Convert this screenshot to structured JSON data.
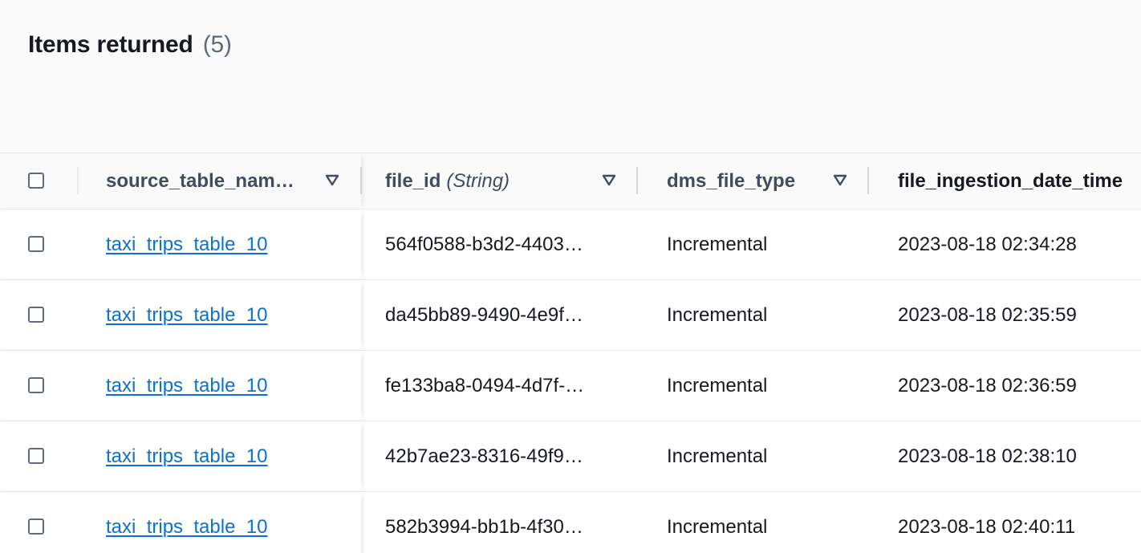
{
  "header": {
    "title": "Items returned",
    "count": "(5)"
  },
  "table": {
    "columns": [
      {
        "label": "source_table_nam…",
        "type": ""
      },
      {
        "label": "file_id",
        "type": "(String)"
      },
      {
        "label": "dms_file_type",
        "type": ""
      },
      {
        "label": "file_ingestion_date_time",
        "type": ""
      }
    ],
    "rows": [
      {
        "source_table_name": "taxi_trips_table_10",
        "file_id": "564f0588-b3d2-4403…",
        "dms_file_type": "Incremental",
        "file_ingestion_date_time": "2023-08-18 02:34:28"
      },
      {
        "source_table_name": "taxi_trips_table_10",
        "file_id": "da45bb89-9490-4e9f…",
        "dms_file_type": "Incremental",
        "file_ingestion_date_time": "2023-08-18 02:35:59"
      },
      {
        "source_table_name": "taxi_trips_table_10",
        "file_id": "fe133ba8-0494-4d7f-…",
        "dms_file_type": "Incremental",
        "file_ingestion_date_time": "2023-08-18 02:36:59"
      },
      {
        "source_table_name": "taxi_trips_table_10",
        "file_id": "42b7ae23-8316-49f9…",
        "dms_file_type": "Incremental",
        "file_ingestion_date_time": "2023-08-18 02:38:10"
      },
      {
        "source_table_name": "taxi_trips_table_10",
        "file_id": "582b3994-bb1b-4f30…",
        "dms_file_type": "Incremental",
        "file_ingestion_date_time": "2023-08-18 02:40:11"
      }
    ]
  },
  "icons": {
    "sort": "caret-down-icon",
    "checkbox": "checkbox-unchecked"
  },
  "colors": {
    "link": "#0972d3",
    "text": "#16191f",
    "header_text": "#414d5c",
    "count_text": "#5f6b7a",
    "border": "#e9ebed",
    "background": "#fafafa"
  }
}
